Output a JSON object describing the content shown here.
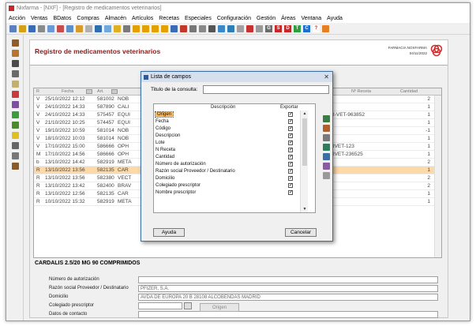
{
  "window": {
    "title": "Nixfarma - [NXF] - [Registro de medicamentos veterinarios]"
  },
  "menu": [
    "Acción",
    "Ventas",
    "BDatos",
    "Compras",
    "Almacén",
    "Artículos",
    "Recetas",
    "Especiales",
    "Configuración",
    "Gestión",
    "Áreas",
    "Ventana",
    "Ayuda"
  ],
  "toolbar": {
    "letters": [
      "G",
      "S",
      "D",
      "T",
      "C",
      "?"
    ]
  },
  "page": {
    "title": "Registro de medicamentos veterinarios",
    "pharmacy": "FARMACIA NOXFARMA",
    "date": "04/11/2022"
  },
  "grid": {
    "headers": {
      "r": "R",
      "fecha": "Fecha",
      "art": "Art.",
      "nreceta": "Nº Receta",
      "cantidad": "Cantidad"
    },
    "rows": [
      {
        "r": "V",
        "fecha": "25/10/2022 12:12",
        "art": "581002",
        "desc": "NOB",
        "receta": "",
        "cant": "2"
      },
      {
        "r": "V",
        "fecha": "24/10/2022 14:33",
        "art": "587890",
        "desc": "CALI",
        "receta": "",
        "cant": "1"
      },
      {
        "r": "V",
        "fecha": "24/10/2022 14:33",
        "art": "575457",
        "desc": "EQUI",
        "receta": "R-VET-963852",
        "cant": "1"
      },
      {
        "r": "V",
        "fecha": "21/10/2022 10:25",
        "art": "574457",
        "desc": "EQUI",
        "receta": "",
        "cant": "1"
      },
      {
        "r": "V",
        "fecha": "19/10/2022 10:59",
        "art": "581014",
        "desc": "NOB",
        "receta": "",
        "cant": "-1"
      },
      {
        "r": "V",
        "fecha": "18/10/2022 10:03",
        "art": "581014",
        "desc": "NOB",
        "receta": "",
        "cant": "1"
      },
      {
        "r": "V",
        "fecha": "17/10/2022 15:00",
        "art": "586666",
        "desc": "OPH",
        "receta": "RVET-123",
        "cant": "1"
      },
      {
        "r": "M",
        "fecha": "17/10/2022 14:56",
        "art": "586666",
        "desc": "OPH",
        "receta": "RVET-236525",
        "cant": "1"
      },
      {
        "r": "b",
        "fecha": "13/10/2022 14:42",
        "art": "582919",
        "desc": "META",
        "receta": "",
        "cant": "2"
      },
      {
        "r": "R",
        "fecha": "13/10/2022 13:56",
        "art": "582135",
        "desc": "CAR",
        "receta": "",
        "cant": "1"
      },
      {
        "r": "R",
        "fecha": "13/10/2022 13:56",
        "art": "582380",
        "desc": "VECT",
        "receta": "",
        "cant": "2"
      },
      {
        "r": "R",
        "fecha": "13/10/2022 13:42",
        "art": "582400",
        "desc": "BRAV",
        "receta": "",
        "cant": "2"
      },
      {
        "r": "R",
        "fecha": "13/10/2022 12:56",
        "art": "582135",
        "desc": "CAR",
        "receta": "",
        "cant": "1"
      },
      {
        "r": "R",
        "fecha": "10/10/2022 15:32",
        "art": "582919",
        "desc": "META",
        "receta": "",
        "cant": "1"
      }
    ]
  },
  "detail": {
    "title": "CARDALIS 2.5/20 MG 90 COMPRIMIDOS",
    "fields": [
      {
        "label": "Número de autorización",
        "value": ""
      },
      {
        "label": "Razón social Proveedor / Destinatario",
        "value": "PFIZER, S.A."
      },
      {
        "label": "Domicilio",
        "value": "AVDA DE EUROPA 20 B 28108 ALCOBENDAS MADRID"
      },
      {
        "label": "Colegiado prescriptor",
        "value": ""
      },
      {
        "label": "Datos de contacto",
        "value": ""
      }
    ],
    "origen_button": "Origen"
  },
  "dialog": {
    "title": "Lista de campos",
    "query_label": "Titulo de la consulta:",
    "query_value": "",
    "col_description": "Descripción",
    "col_export": "Exportar",
    "items": [
      "Origen",
      "Fecha",
      "Código",
      "Descripcion",
      "Lote",
      "N Receta",
      "Cantidad",
      "Número de autorización",
      "Razón social Proveedor / Destinatario",
      "Domicilio",
      "Colegiado prescriptor",
      "Nombre prescriptor"
    ],
    "help_button": "Ayuda",
    "cancel_button": "Cancelar"
  }
}
